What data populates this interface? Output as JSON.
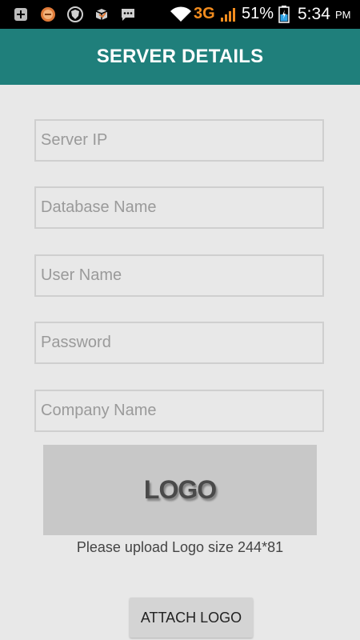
{
  "status_bar": {
    "network_type": "3G",
    "battery_percent": "51%",
    "time": "5:34",
    "time_suffix": "PM",
    "notification_icons": [
      "add-icon",
      "ram-icon",
      "shield-icon",
      "box-icon",
      "chat-icon"
    ],
    "system_icons": [
      "wifi-icon",
      "signal-icon",
      "battery-icon"
    ],
    "colors": {
      "background": "#000000",
      "network_color": "#f28c1e"
    }
  },
  "header": {
    "title": "SERVER DETAILS",
    "background": "#1f7f7b"
  },
  "form": {
    "fields": [
      {
        "name": "server-ip",
        "placeholder": "Server IP",
        "value": ""
      },
      {
        "name": "database-name",
        "placeholder": "Database Name",
        "value": ""
      },
      {
        "name": "user-name",
        "placeholder": "User Name",
        "value": ""
      },
      {
        "name": "password",
        "placeholder": "Password",
        "value": ""
      },
      {
        "name": "company-name",
        "placeholder": "Company Name",
        "value": ""
      }
    ]
  },
  "logo": {
    "text": "LOGO",
    "hint": "Please upload Logo size 244*81"
  },
  "actions": {
    "attach_logo_label": "ATTACH LOGO"
  }
}
